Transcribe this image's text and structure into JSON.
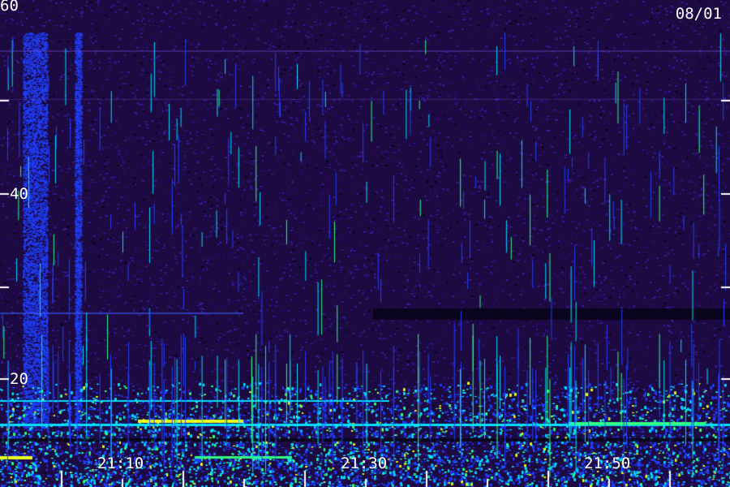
{
  "display": {
    "date": "08/01",
    "y_tick_labels": [
      "60",
      "40",
      "20"
    ],
    "time_labels": [
      "21:10",
      "21:30",
      "21:50"
    ],
    "colors": {
      "background": "#1c0a40",
      "noise_low": "#2a0f6a",
      "noise_high": "#3b1ea0",
      "blue": "#2040ff",
      "cyan": "#00e0ff",
      "green": "#30ff80",
      "yellow": "#e8ff20",
      "tick": "#ffffff"
    }
  }
}
